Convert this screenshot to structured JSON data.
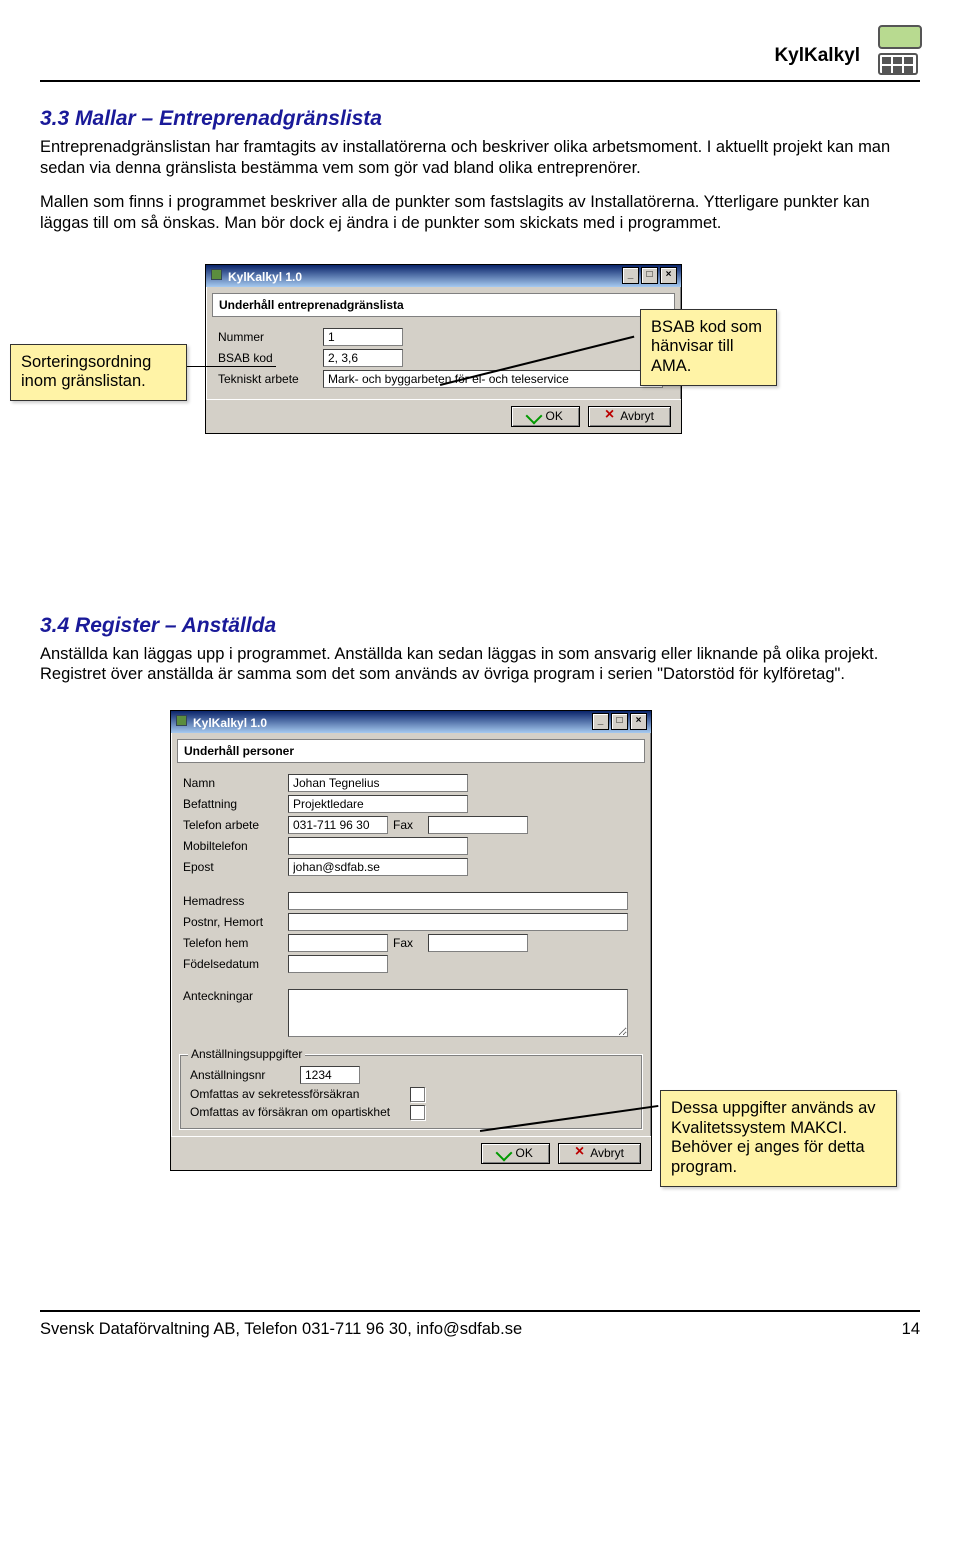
{
  "header": {
    "doc_title": "KylKalkyl"
  },
  "section33": {
    "heading": "3.3 Mallar – Entreprenadgränslista",
    "p1": "Entreprenadgränslistan har framtagits av installatörerna och beskriver olika arbetsmoment. I aktuellt projekt kan man sedan via denna gränslista bestämma vem som gör vad bland olika entreprenörer.",
    "p2": "Mallen som finns i programmet beskriver alla de punkter som fastslagits av Installatörerna. Ytterligare punkter kan läggas till om så önskas. Man bör dock ej ändra i de punkter som skickats med i programmet."
  },
  "callouts33": {
    "left": "Sorteringsordning inom gränslistan.",
    "right": "BSAB kod som hänvisar till AMA."
  },
  "dialog1": {
    "window_title": "KylKalkyl 1.0",
    "heading": "Underhåll entreprenadgränslista",
    "labels": {
      "nummer": "Nummer",
      "bsab": "BSAB kod",
      "tekniskt": "Tekniskt arbete"
    },
    "values": {
      "nummer": "1",
      "bsab": "2, 3,6",
      "tekniskt": "Mark- och byggarbeten för el- och teleservice"
    },
    "ok": "OK",
    "cancel": "Avbryt"
  },
  "section34": {
    "heading": "3.4 Register – Anställda",
    "p1": "Anställda kan läggas upp i programmet. Anställda kan sedan läggas in som ansvarig eller liknande på olika projekt. Registret över anställda är samma som det som används av övriga program i serien \"Datorstöd för kylföretag\"."
  },
  "dialog2": {
    "window_title": "KylKalkyl 1.0",
    "heading": "Underhåll personer",
    "labels": {
      "namn": "Namn",
      "befattning": "Befattning",
      "tel_arbete": "Telefon arbete",
      "fax": "Fax",
      "mobil": "Mobiltelefon",
      "epost": "Epost",
      "hemadr": "Hemadress",
      "postnr": "Postnr, Hemort",
      "tel_hem": "Telefon hem",
      "fodelse": "Födelsedatum",
      "anteckn": "Anteckningar",
      "group": "Anställningsuppgifter",
      "anstnr": "Anställningsnr",
      "sekretess": "Omfattas av sekretessförsäkran",
      "opartiskhet": "Omfattas av försäkran om opartiskhet"
    },
    "values": {
      "namn": "Johan Tegnelius",
      "befattning": "Projektledare",
      "tel_arbete": "031-711 96 30",
      "fax": "",
      "mobil": "",
      "epost": "johan@sdfab.se",
      "hemadr": "",
      "postnr": "",
      "tel_hem": "",
      "fax2": "",
      "fodelse": "",
      "anteckn": "",
      "anstnr": "1234"
    },
    "ok": "OK",
    "cancel": "Avbryt"
  },
  "callouts34": {
    "right": "Dessa uppgifter används av Kvalitetssystem MAKCI. Behöver ej anges för detta program."
  },
  "footer": {
    "left": "Svensk Dataförvaltning AB, Telefon 031-711 96 30, info@sdfab.se",
    "page": "14"
  }
}
